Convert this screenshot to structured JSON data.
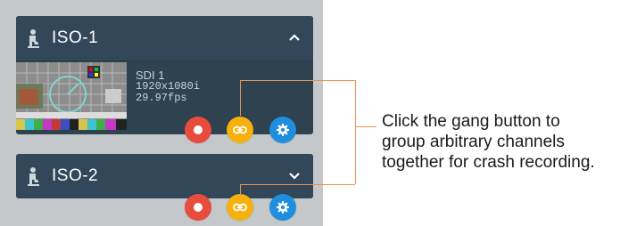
{
  "channels": [
    {
      "title": "ISO-1",
      "expanded": true,
      "signal": {
        "source": "SDI 1",
        "resolution": "1920x1080i",
        "framerate": "29.97fps"
      }
    },
    {
      "title": "ISO-2",
      "expanded": false
    }
  ],
  "buttons": {
    "record_icon": "record-icon",
    "gang_icon": "link-icon",
    "settings_icon": "gear-icon"
  },
  "colors": {
    "card": "#2f4250",
    "record": "#e74c3c",
    "gang": "#f6b10f",
    "settings": "#1f8fdd",
    "callout_line": "#e99454"
  },
  "callout": {
    "lines": [
      "Click the gang button to",
      "group arbitrary channels",
      "together for crash recording."
    ]
  }
}
